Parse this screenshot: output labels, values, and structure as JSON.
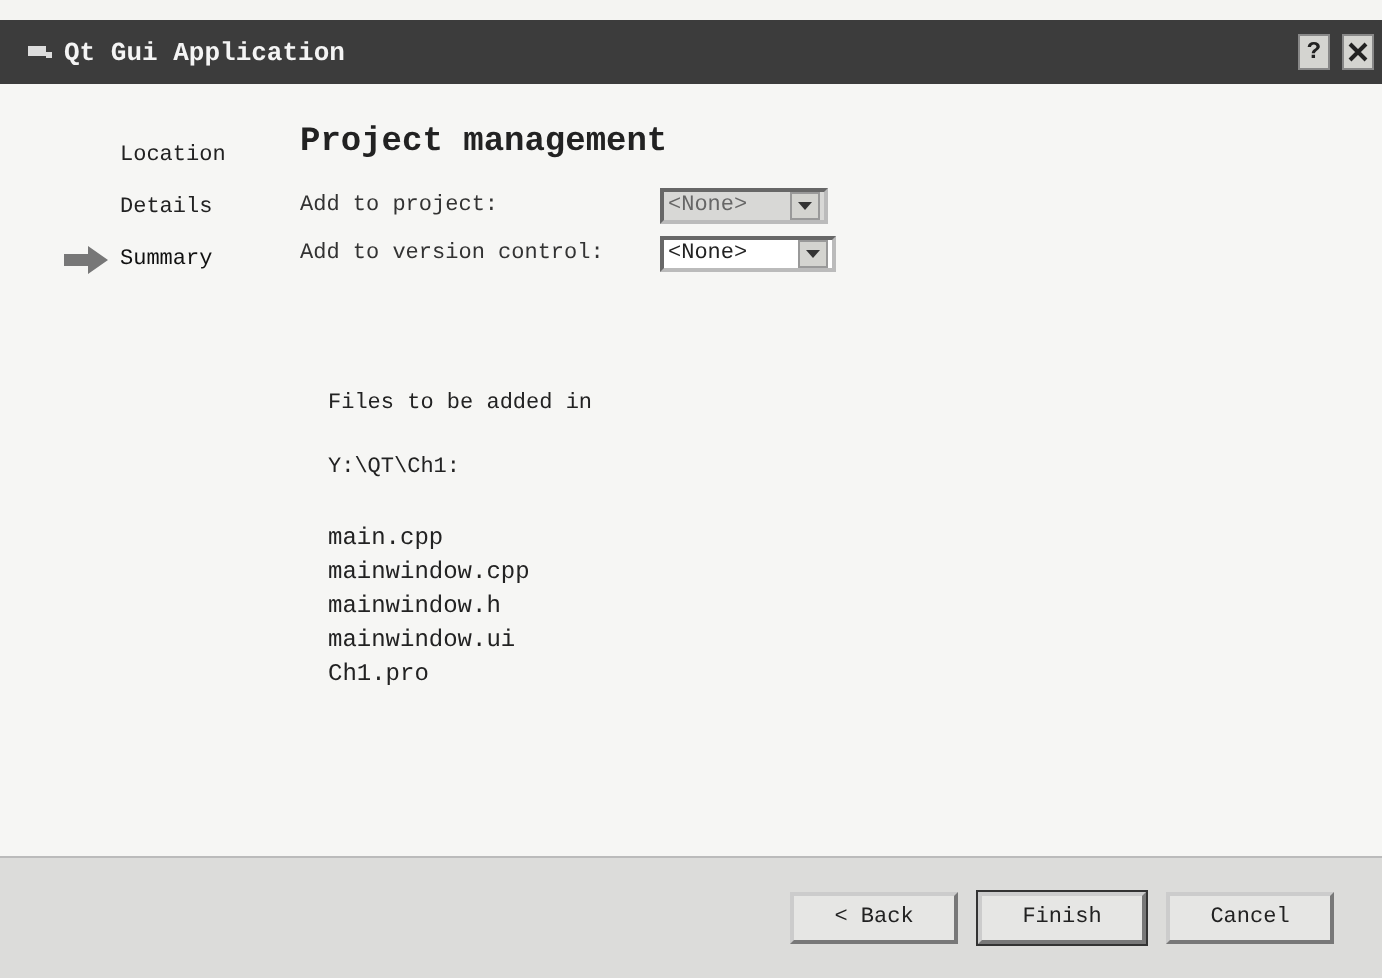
{
  "window": {
    "title": "Qt Gui Application",
    "help_button": "?"
  },
  "steps": [
    {
      "label": "Location",
      "selected": false
    },
    {
      "label": "Details",
      "selected": false
    },
    {
      "label": "Summary",
      "selected": true
    }
  ],
  "page_title": "Project management",
  "fields": [
    {
      "label": "Add to project:",
      "value": "<None>",
      "disabled": true
    },
    {
      "label": "Add to version control:",
      "value": "<None>",
      "disabled": false
    }
  ],
  "summary": {
    "heading": "Files to be added in",
    "path": "Y:\\QT\\Ch1:",
    "files": [
      "main.cpp",
      "mainwindow.cpp",
      "mainwindow.h",
      "mainwindow.ui",
      "Ch1.pro"
    ]
  },
  "buttons": [
    {
      "label": "< Back",
      "default": false
    },
    {
      "label": "Finish",
      "default": true
    },
    {
      "label": "Cancel",
      "default": false
    }
  ]
}
